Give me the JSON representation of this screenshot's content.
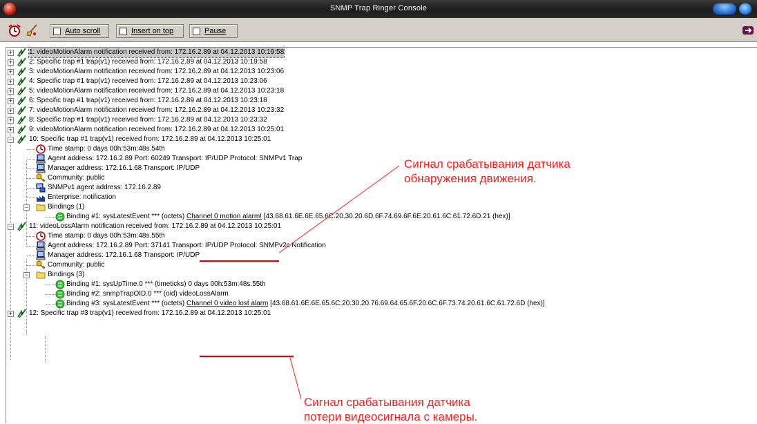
{
  "window": {
    "title": "SNMP Trap Ringer Console"
  },
  "toolbar": {
    "auto_scroll": "Auto scroll",
    "insert_on_top": "Insert on top",
    "pause": "Pause"
  },
  "traps": [
    "1: videoMotionAlarm notification received from: 172.16.2.89 at 04.12.2013 10:19:58",
    "2: Specific trap #1 trap(v1) received from: 172.16.2.89 at 04.12.2013 10:19:58",
    "3: videoMotionAlarm notification received from: 172.16.2.89 at 04.12.2013 10:23:06",
    "4: Specific trap #1 trap(v1) received from: 172.16.2.89 at 04.12.2013 10:23:06",
    "5: videoMotionAlarm notification received from: 172.16.2.89 at 04.12.2013 10:23:18",
    "6: Specific trap #1 trap(v1) received from: 172.16.2.89 at 04.12.2013 10:23:18",
    "7: videoMotionAlarm notification received from: 172.16.2.89 at 04.12.2013 10:23:32",
    "8: Specific trap #1 trap(v1) received from: 172.16.2.89 at 04.12.2013 10:23:32",
    "9: videoMotionAlarm notification received from: 172.16.2.89 at 04.12.2013 10:25:01"
  ],
  "trap10": {
    "header": "10: Specific trap #1 trap(v1) received from: 172.16.2.89 at 04.12.2013 10:25:01",
    "timestamp": "Time stamp: 0 days 00h:53m:48s.54th",
    "agent": "Agent address: 172.16.2.89 Port: 60249 Transport: IP/UDP Protocol: SNMPv1 Trap",
    "manager": "Manager address: 172.16.1.68 Transport: IP/UDP",
    "community": "Community: public",
    "snmpv1_agent": "SNMPv1 agent address: 172.16.2.89",
    "enterprise": "Enterprise: notification",
    "bindings": "Bindings (1)",
    "binding1_prefix": "Binding #1: sysLatestEvent *** (octets) ",
    "binding1_value": "Channel 0 motion alarm!",
    "binding1_suffix": " [43.68.61.6E.6E.65.6C.20.30.20.6D.6F.74.69.6F.6E.20.61.6C.61.72.6D.21 (hex)]"
  },
  "trap11": {
    "header": "11: videoLossAlarm notification received from: 172.16.2.89 at 04.12.2013 10:25:01",
    "timestamp": "Time stamp: 0 days 00h:53m:48s.55th",
    "agent": "Agent address: 172.16.2.89 Port: 37141 Transport: IP/UDP Protocol: SNMPv2c Notification",
    "manager": "Manager address: 172.16.1.68 Transport: IP/UDP",
    "community": "Community: public",
    "bindings": "Bindings (3)",
    "binding1": "Binding #1: sysUpTime.0 *** (timeticks) 0 days 00h:53m:48s.55th",
    "binding2": "Binding #2: snmpTrapOID.0 *** (oid) videoLossAlarm",
    "binding3_prefix": "Binding #3: sysLatestEvent *** (octets) ",
    "binding3_value": "Channel 0 video lost alarm",
    "binding3_suffix": " [43.68.61.6E.6E.65.6C.20.30.20.76.69.64.65.6F.20.6C.6F.73.74.20.61.6C.61.72.6D (hex)]"
  },
  "trap12": "12: Specific trap #3 trap(v1) received from: 172.16.2.89 at 04.12.2013 10:25:01",
  "annotations": {
    "motion_line1": "Сигнал срабатывания датчика",
    "motion_line2": "обнаружения движения.",
    "video_line1": "Сигнал срабатывания датчика",
    "video_line2": "потери видеосигнала с камеры."
  },
  "colors": {
    "annotation": "#ff1a1a",
    "titlebar": "#2a2a2a",
    "toolbar": "#d4d0c8"
  }
}
